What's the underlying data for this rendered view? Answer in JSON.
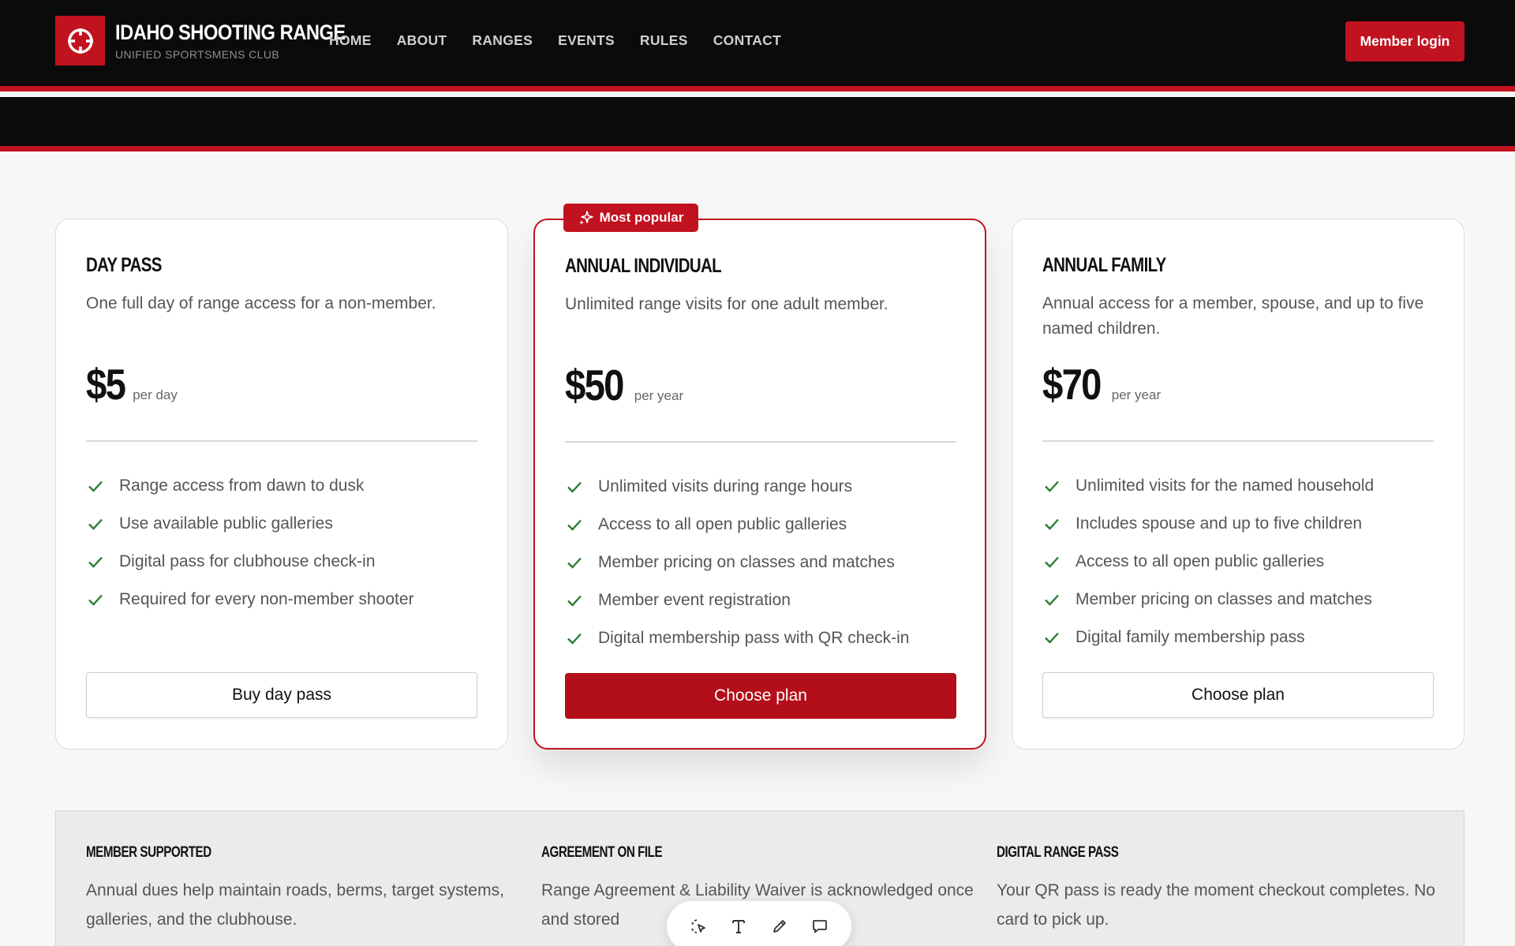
{
  "header": {
    "brand_title": "IDAHO SHOOTING RANGE",
    "brand_subtitle": "UNIFIED SPORTSMENS CLUB",
    "logo_icon": "crosshair-icon",
    "nav": [
      "HOME",
      "ABOUT",
      "RANGES",
      "EVENTS",
      "RULES",
      "CONTACT"
    ],
    "login_label": "Member login"
  },
  "colors": {
    "accent": "#c1121f",
    "header_bg": "#0b0b0c",
    "check": "#2e7d32"
  },
  "badge": {
    "label": "Most popular",
    "icon": "sparkle-icon"
  },
  "plans": [
    {
      "title": "DAY PASS",
      "description": "One full day of range access for a non-member.",
      "price": "$5",
      "period": "per day",
      "features": [
        "Range access from dawn to dusk",
        "Use available public galleries",
        "Digital pass for clubhouse check-in",
        "Required for every non-member shooter"
      ],
      "button": "Buy day pass"
    },
    {
      "title": "ANNUAL INDIVIDUAL",
      "description": "Unlimited range visits for one adult member.",
      "price": "$50",
      "period": "per year",
      "features": [
        "Unlimited visits during range hours",
        "Access to all open public galleries",
        "Member pricing on classes and matches",
        "Member event registration",
        "Digital membership pass with QR check-in"
      ],
      "button": "Choose plan"
    },
    {
      "title": "ANNUAL FAMILY",
      "description": "Annual access for a member, spouse, and up to five named children.",
      "price": "$70",
      "period": "per year",
      "features": [
        "Unlimited visits for the named household",
        "Includes spouse and up to five children",
        "Access to all open public galleries",
        "Member pricing on classes and matches",
        "Digital family membership pass"
      ],
      "button": "Choose plan"
    }
  ],
  "info": [
    {
      "title": "MEMBER SUPPORTED",
      "text": "Annual dues help maintain roads, berms, target systems, galleries, and the clubhouse."
    },
    {
      "title": "AGREEMENT ON FILE",
      "text": "Range Agreement & Liability Waiver is acknowledged once and stored"
    },
    {
      "title": "DIGITAL RANGE PASS",
      "text": "Your QR pass is ready the moment checkout completes. No card to pick up."
    }
  ],
  "toolbar": {
    "tools": [
      "select-icon",
      "text-icon",
      "pencil-icon",
      "comment-icon"
    ]
  }
}
